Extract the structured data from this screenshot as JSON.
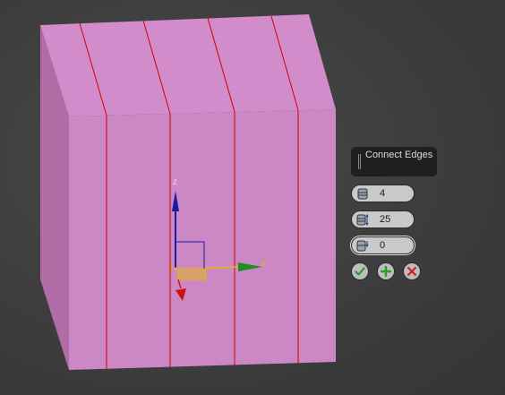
{
  "caddy": {
    "title": "Connect Edges",
    "fields": [
      {
        "icon": "segments-icon",
        "value": "4"
      },
      {
        "icon": "pinch-icon",
        "value": "25"
      },
      {
        "icon": "slide-icon",
        "value": "0"
      }
    ],
    "buttons": [
      {
        "icon": "checkmark-icon",
        "color": "#2e9a2e"
      },
      {
        "icon": "plus-icon",
        "color": "#2e9a2e"
      },
      {
        "icon": "close-icon",
        "color": "#d02020"
      }
    ]
  },
  "gizmo": {
    "axis_labels": {
      "z": "z",
      "y": "y"
    },
    "colors": {
      "x": "#cc1111",
      "y": "#1f8f1f",
      "z": "#1a1aa8",
      "plane": "#e6b800"
    }
  },
  "object": {
    "face_color": "#cc88c4",
    "top_color": "#d28ccb",
    "side_color": "#b06da5",
    "edge_color": "#d40000"
  }
}
